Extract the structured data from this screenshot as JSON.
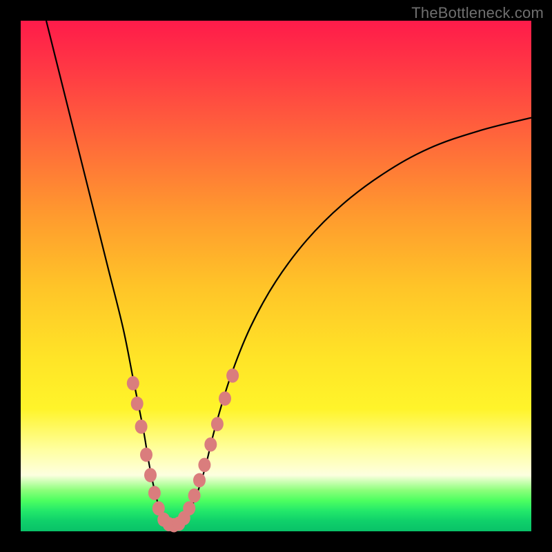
{
  "watermark": "TheBottleneck.com",
  "colors": {
    "frame": "#000000",
    "curve_stroke": "#000000",
    "marker_fill": "#da7d7d",
    "marker_stroke": "#c06a6a"
  },
  "chart_data": {
    "type": "line",
    "title": "",
    "xlabel": "",
    "ylabel": "",
    "xlim": [
      0,
      100
    ],
    "ylim": [
      0,
      100
    ],
    "grid": false,
    "legend": false,
    "series": [
      {
        "name": "bottleneck-curve",
        "x": [
          5,
          8,
          11,
          14,
          17,
          20,
          22,
          24,
          25,
          26,
          27,
          28,
          29,
          30,
          31,
          32,
          34,
          36,
          38,
          41,
          45,
          50,
          56,
          63,
          71,
          80,
          90,
          100
        ],
        "y": [
          100,
          88,
          76,
          64,
          52,
          40,
          30,
          20,
          14,
          9,
          5,
          2.5,
          1.5,
          1.2,
          1.5,
          2.5,
          6,
          12,
          20,
          30,
          40,
          49,
          57,
          64,
          70,
          75,
          78.5,
          81
        ]
      }
    ],
    "markers": [
      {
        "x": 22.0,
        "y": 29.0
      },
      {
        "x": 22.8,
        "y": 25.0
      },
      {
        "x": 23.6,
        "y": 20.5
      },
      {
        "x": 24.6,
        "y": 15.0
      },
      {
        "x": 25.4,
        "y": 11.0
      },
      {
        "x": 26.2,
        "y": 7.5
      },
      {
        "x": 27.0,
        "y": 4.5
      },
      {
        "x": 28.0,
        "y": 2.3
      },
      {
        "x": 29.0,
        "y": 1.4
      },
      {
        "x": 30.0,
        "y": 1.2
      },
      {
        "x": 31.0,
        "y": 1.5
      },
      {
        "x": 32.0,
        "y": 2.6
      },
      {
        "x": 33.0,
        "y": 4.5
      },
      {
        "x": 34.0,
        "y": 7.0
      },
      {
        "x": 35.0,
        "y": 10.0
      },
      {
        "x": 36.0,
        "y": 13.0
      },
      {
        "x": 37.2,
        "y": 17.0
      },
      {
        "x": 38.5,
        "y": 21.0
      },
      {
        "x": 40.0,
        "y": 26.0
      },
      {
        "x": 41.5,
        "y": 30.5
      }
    ],
    "marker_radius_px": 9
  }
}
